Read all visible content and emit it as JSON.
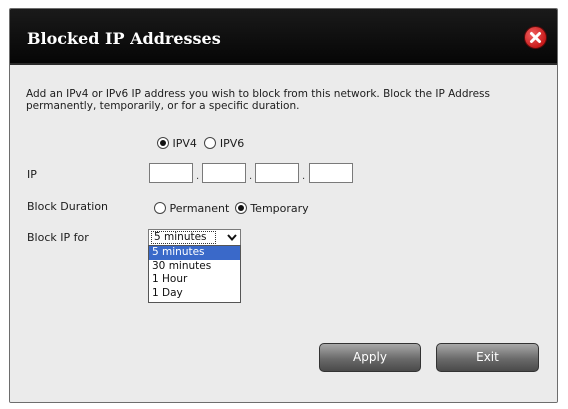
{
  "dialog": {
    "title": "Blocked IP Addresses",
    "description": "Add an IPv4 or IPv6 IP address you wish to block from this network. Block the IP Address permanently, temporarily, or for a specific duration."
  },
  "ip_version": {
    "options": [
      "IPV4",
      "IPV6"
    ],
    "selected": "IPV4"
  },
  "ip": {
    "label": "IP",
    "octets": [
      "",
      "",
      "",
      ""
    ],
    "separators": [
      ".",
      ".",
      "."
    ]
  },
  "block_duration": {
    "label": "Block Duration",
    "options": [
      "Permanent",
      "Temporary"
    ],
    "selected": "Temporary"
  },
  "block_ip_for": {
    "label": "Block IP for",
    "value": "5 minutes",
    "options": [
      "5 minutes",
      "30 minutes",
      "1 Hour",
      "1 Day"
    ],
    "highlighted": "5 minutes"
  },
  "buttons": {
    "apply": "Apply",
    "exit": "Exit"
  },
  "icons": {
    "close": "close-icon",
    "dropdown": "chevron-down-icon"
  },
  "colors": {
    "titlebar": "#0d0d0d",
    "close": "#d42a2a",
    "dropdown_highlight": "#3a69c9",
    "dialog_body": "#ebebeb"
  }
}
